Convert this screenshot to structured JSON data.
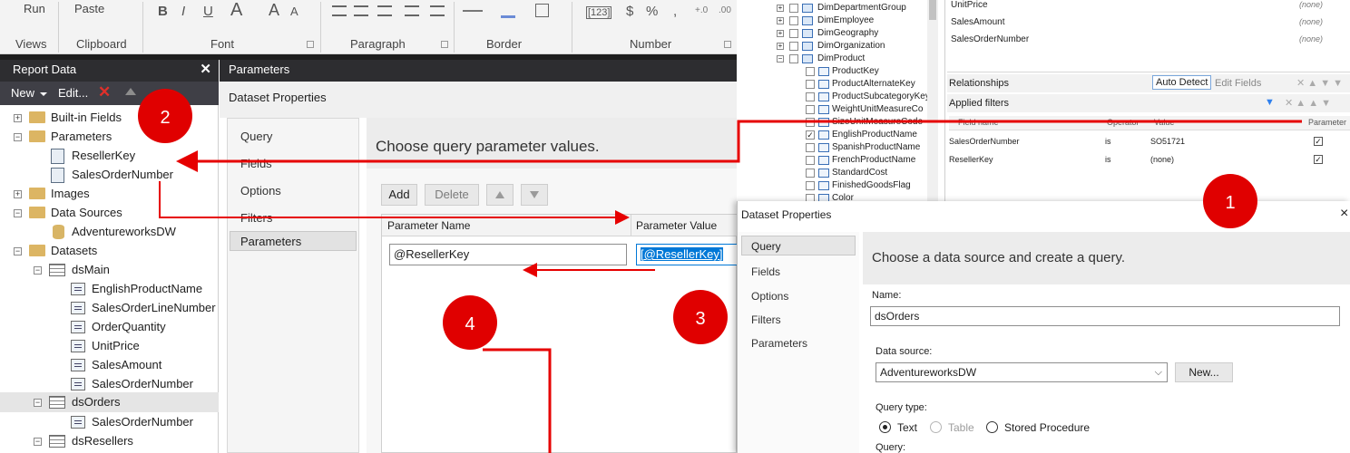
{
  "ribbon": {
    "run": "Run",
    "paste": "Paste",
    "groups": [
      "Views",
      "Clipboard",
      "Font",
      "Paragraph",
      "Border",
      "Number"
    ],
    "font_tools": [
      "B",
      "I",
      "U",
      "A",
      "A",
      "A"
    ],
    "number_tools": [
      "[123]",
      "$",
      "%",
      ","
    ]
  },
  "report_data": {
    "title": "Report Data",
    "toolbar": {
      "new": "New",
      "edit": "Edit..."
    },
    "tree": {
      "builtin": "Built-in Fields",
      "parameters": "Parameters",
      "params": [
        "ResellerKey",
        "SalesOrderNumber"
      ],
      "images": "Images",
      "data_sources": "Data Sources",
      "data_source_items": [
        "AdventureworksDW"
      ],
      "datasets": "Datasets",
      "ds_main": "dsMain",
      "ds_main_fields": [
        "EnglishProductName",
        "SalesOrderLineNumber",
        "OrderQuantity",
        "UnitPrice",
        "SalesAmount",
        "SalesOrderNumber"
      ],
      "ds_orders": "dsOrders",
      "ds_orders_fields": [
        "SalesOrderNumber"
      ],
      "ds_resellers": "dsResellers"
    }
  },
  "param_dialog": {
    "bar": "Parameters",
    "title": "Dataset Properties",
    "nav": [
      "Query",
      "Fields",
      "Options",
      "Filters",
      "Parameters"
    ],
    "heading": "Choose query parameter values.",
    "buttons": {
      "add": "Add",
      "delete": "Delete"
    },
    "col_name": "Parameter Name",
    "col_value": "Parameter Value",
    "row_name": "@ResellerKey",
    "row_value": "[@ResellerKey]"
  },
  "query_designer": {
    "tables": [
      "DimDepartmentGroup",
      "DimEmployee",
      "DimGeography",
      "DimOrganization",
      "DimProduct"
    ],
    "product_columns": [
      {
        "name": "ProductKey",
        "checked": false
      },
      {
        "name": "ProductAlternateKey",
        "checked": false
      },
      {
        "name": "ProductSubcategoryKey",
        "checked": false
      },
      {
        "name": "WeightUnitMeasureCo",
        "checked": false
      },
      {
        "name": "SizeUnitMeasureCode",
        "checked": false
      },
      {
        "name": "EnglishProductName",
        "checked": true
      },
      {
        "name": "SpanishProductName",
        "checked": false
      },
      {
        "name": "FrenchProductName",
        "checked": false
      },
      {
        "name": "StandardCost",
        "checked": false
      },
      {
        "name": "FinishedGoodsFlag",
        "checked": false
      },
      {
        "name": "Color",
        "checked": false
      }
    ],
    "selected_fields": [
      {
        "name": "UnitPrice",
        "agg": "(none)"
      },
      {
        "name": "SalesAmount",
        "agg": "(none)"
      },
      {
        "name": "SalesOrderNumber",
        "agg": "(none)"
      }
    ],
    "relationships": "Relationships",
    "auto_detect": "Auto Detect",
    "edit_fields": "Edit Fields",
    "applied_filters": "Applied filters",
    "filter_headers": [
      "Field name",
      "Operator",
      "Value",
      "Parameter"
    ],
    "filters": [
      {
        "field": "SalesOrderNumber",
        "op": "is",
        "value": "SO51721",
        "param": true
      },
      {
        "field": "ResellerKey",
        "op": "is",
        "value": "(none)",
        "param": true
      }
    ]
  },
  "dataset_props2": {
    "title": "Dataset Properties",
    "close": "×",
    "nav": [
      "Query",
      "Fields",
      "Options",
      "Filters",
      "Parameters"
    ],
    "heading": "Choose a data source and create a query.",
    "name_label": "Name:",
    "name_value": "dsOrders",
    "ds_label": "Data source:",
    "ds_value": "AdventureworksDW",
    "new_button": "New...",
    "qt_label": "Query type:",
    "qt_options": [
      {
        "label": "Text",
        "selected": true
      },
      {
        "label": "Table",
        "selected": false,
        "disabled": true
      },
      {
        "label": "Stored Procedure",
        "selected": false
      }
    ],
    "query_label": "Query:"
  },
  "callouts": [
    "1",
    "2",
    "3",
    "4"
  ],
  "colors": {
    "annotation": "#e60000",
    "dark_bar": "#2d2d30",
    "selection": "#0078d7"
  }
}
